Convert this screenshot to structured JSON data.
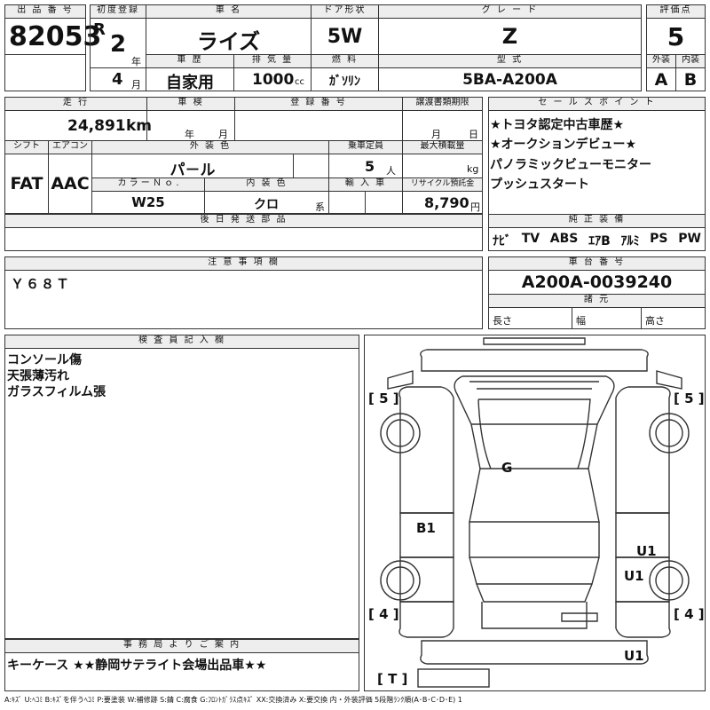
{
  "top": {
    "lot_header": "出 品 番 号",
    "lot_number": "82053",
    "first_reg_header": "初度登録",
    "era": "R",
    "year_value": "2",
    "year_unit": "年",
    "month_value": "4",
    "month_unit": "月",
    "car_name_header": "車 名",
    "car_name": "ライズ",
    "door_header": "ドア形状",
    "door": "5W",
    "grade_header": "グ レ ー ド",
    "grade": "Z",
    "score_header": "評価点",
    "score": "5",
    "history_header": "車 歴",
    "history": "自家用",
    "displacement_header": "排 気 量",
    "displacement": "1000",
    "displacement_unit": "cc",
    "fuel_header": "燃 料",
    "fuel": "ｶﾞｿﾘﾝ",
    "model_header": "型 式",
    "model": "5BA-A200A",
    "exterior_grade_header": "外装",
    "exterior_grade": "A",
    "interior_grade_header": "内装",
    "interior_grade": "B"
  },
  "mid": {
    "mileage_header": "走 行",
    "mileage": "24,891",
    "mileage_unit": "km",
    "inspection_header": "車 検",
    "inspection_year_unit": "年",
    "inspection_month_unit": "月",
    "registration_header": "登 録 番 号",
    "transfer_header": "譲渡書類期限",
    "transfer_month_unit": "月",
    "transfer_day_unit": "日",
    "shift_header": "シフト",
    "shift": "FAT",
    "ac_header": "エアコン",
    "ac": "AAC",
    "exterior_color_header": "外 装 色",
    "exterior_color": "パ－ル",
    "capacity_header": "乗車定員",
    "capacity": "5",
    "capacity_unit": "人",
    "max_load_header": "最大積載量",
    "max_load_unit": "kg",
    "color_no_header": "カ ラ ー Ｎ ｏ .",
    "color_no": "W25",
    "interior_color_header": "内 装 色",
    "interior_color": "クロ",
    "interior_color_unit": "系",
    "import_header": "輸 入 車",
    "recycle_header": "リサイクル預託金",
    "recycle": "8,790",
    "recycle_unit": "円",
    "later_parts_header": "後 日 発 送 部 品"
  },
  "sales": {
    "header": "セ ー ル ス ポ イ ン ト",
    "points": [
      "★トヨタ認定中古車歴★",
      "★オークションデビュー★",
      "パノラミックビューモニター",
      "プッシュスタート"
    ]
  },
  "equipment": {
    "header": "純 正 装 備",
    "items": [
      "ﾅﾋﾞ",
      "TV",
      "ABS",
      "ｴｱB",
      "ｱﾙﾐ",
      "PS",
      "PW"
    ]
  },
  "notes": {
    "header": "注 意 事 項 欄",
    "text": "Ｙ６８Ｔ"
  },
  "chassis": {
    "header": "車 台 番 号",
    "number": "A200A-0039240",
    "dims_header": "諸 元",
    "length_label": "長さ",
    "width_label": "幅",
    "height_label": "高さ"
  },
  "inspector": {
    "header": "検 査 員 記 入 欄",
    "lines": [
      "コンソール傷",
      "天張薄汚れ",
      "ガラスフィルム張"
    ]
  },
  "diagram": {
    "tire_front_left": "[ 5 ]",
    "tire_front_right": "[ 5 ]",
    "tire_rear_left": "[ 4 ]",
    "tire_rear_right": "[ 4 ]",
    "spare": "[ T ]",
    "marks": [
      {
        "id": "g",
        "text": "G"
      },
      {
        "id": "b1",
        "text": "B1"
      },
      {
        "id": "u1_a",
        "text": "U1"
      },
      {
        "id": "u1_b",
        "text": "U1"
      },
      {
        "id": "u1_c",
        "text": "U1"
      }
    ]
  },
  "office": {
    "header": "事 務 局 よ り ご 案 内",
    "text": "キーケース ★★静岡サテライト会場出品車★★"
  },
  "legend": "A:ｷｽﾞ U:ﾍｺﾐ B:ｷｽﾞを伴うﾍｺﾐ P:要塗装 W:補修跡 S:錆 C:腐食 G:ﾌﾛﾝﾄｶﾞﾗｽ点ｷｽﾞ XX:交換済み X:要交換 内・外装評価 5段階ﾗﾝｸ順(A･B･C･D･E) 1"
}
